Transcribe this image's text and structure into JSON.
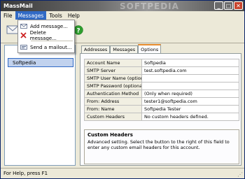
{
  "window": {
    "title": "MassMail",
    "watermark": "SOFTPEDIA",
    "buttons": {
      "minimize": "_",
      "maximize": "□",
      "close": "✕"
    }
  },
  "menubar": {
    "items": [
      "File",
      "Messages",
      "Tools",
      "Help"
    ]
  },
  "messages_menu": {
    "items": [
      {
        "label": "Add message...",
        "icon": "add-message-icon"
      },
      {
        "label": "Delete message...",
        "icon": "delete-icon"
      },
      {
        "label": "Send a mailout...",
        "icon": "send-mailout-icon"
      }
    ]
  },
  "toolbar": {
    "icons": [
      "envelope-icon",
      "help-icon"
    ]
  },
  "accounts": {
    "items": [
      {
        "label": "",
        "selected": false
      },
      {
        "label": "Softpedia",
        "selected": true
      }
    ]
  },
  "tabs": [
    {
      "label": "Addresses",
      "active": false
    },
    {
      "label": "Messages",
      "active": false
    },
    {
      "label": "Options",
      "active": true
    }
  ],
  "options": {
    "rows": [
      {
        "key": "Account Name",
        "value": "Softpedia"
      },
      {
        "key": "SMTP Server",
        "value": "test.softpedia.com"
      },
      {
        "key": "SMTP User Name (optional)",
        "value": ""
      },
      {
        "key": "SMTP Password (optional)",
        "value": ""
      },
      {
        "key": "Authentication Method",
        "value": "(Only when required)"
      },
      {
        "key": "From: Address",
        "value": "tester1@softpedia.com"
      },
      {
        "key": "From: Name",
        "value": "Softpedia Tester"
      },
      {
        "key": "Custom Headers",
        "value": "No custom headers defined."
      }
    ]
  },
  "help": {
    "title": "Custom Headers",
    "text": "Advanced setting. Select the button to the right of this field to enter any custom email headers for this account."
  },
  "status": {
    "text": "For Help, press F1"
  },
  "colors": {
    "menu_highlight": "#316ac5",
    "tab_active_accent": "#e68b2c",
    "delete_red": "#cc2222",
    "help_green": "#2e9e2e"
  }
}
